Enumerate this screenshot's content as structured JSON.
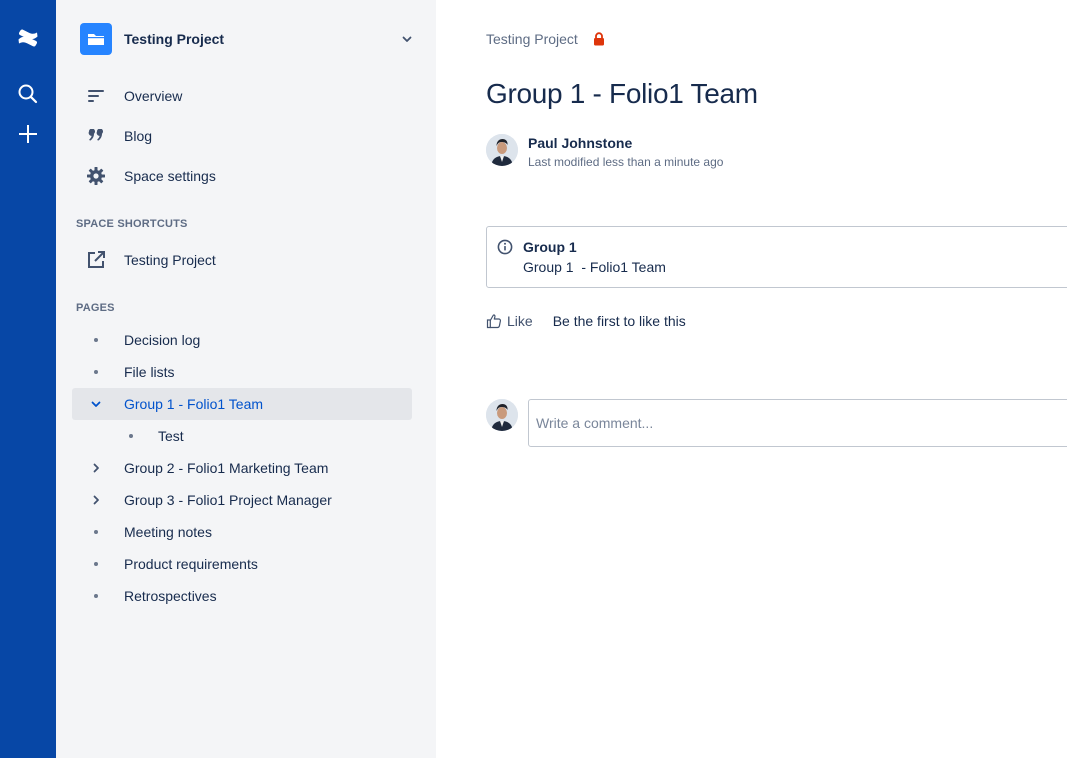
{
  "global_nav": {
    "logo_icon": "confluence-logo-icon",
    "items": [
      {
        "icon": "search-icon"
      },
      {
        "icon": "plus-icon"
      }
    ]
  },
  "sidebar": {
    "space": {
      "name": "Testing Project",
      "icon": "folder-icon"
    },
    "nav": [
      {
        "label": "Overview",
        "icon": "overview-lines-icon"
      },
      {
        "label": "Blog",
        "icon": "quote-icon"
      },
      {
        "label": "Space settings",
        "icon": "gear-icon"
      }
    ],
    "shortcuts_heading": "SPACE SHORTCUTS",
    "shortcuts": [
      {
        "label": "Testing Project",
        "icon": "external-link-icon"
      }
    ],
    "pages_heading": "PAGES",
    "pages": [
      {
        "label": "Decision log",
        "state": "leaf"
      },
      {
        "label": "File lists",
        "state": "leaf"
      },
      {
        "label": "Group 1 - Folio1 Team",
        "state": "expanded",
        "selected": true
      },
      {
        "label": "Test",
        "state": "child"
      },
      {
        "label": "Group 2 - Folio1 Marketing Team",
        "state": "collapsed"
      },
      {
        "label": "Group 3 - Folio1 Project Manager",
        "state": "collapsed"
      },
      {
        "label": "Meeting notes",
        "state": "leaf"
      },
      {
        "label": "Product requirements",
        "state": "leaf"
      },
      {
        "label": "Retrospectives",
        "state": "leaf"
      }
    ]
  },
  "main": {
    "breadcrumb": "Testing Project",
    "restriction_icon": "lock-icon",
    "title": "Group 1 - Folio1 Team",
    "byline": {
      "author": "Paul Johnstone",
      "modified": "Last modified less than a minute ago"
    },
    "info_panel": {
      "title": "Group 1",
      "body": "Group 1  - Folio1 Team"
    },
    "like": {
      "label": "Like",
      "text": "Be the first to like this"
    },
    "comment": {
      "placeholder": "Write a comment..."
    }
  },
  "colors": {
    "nav_blue": "#0747a6",
    "sidebar_bg": "#f4f5f7",
    "link_blue": "#0052cc",
    "lock_red": "#de350b",
    "space_avatar": "#2684ff"
  }
}
